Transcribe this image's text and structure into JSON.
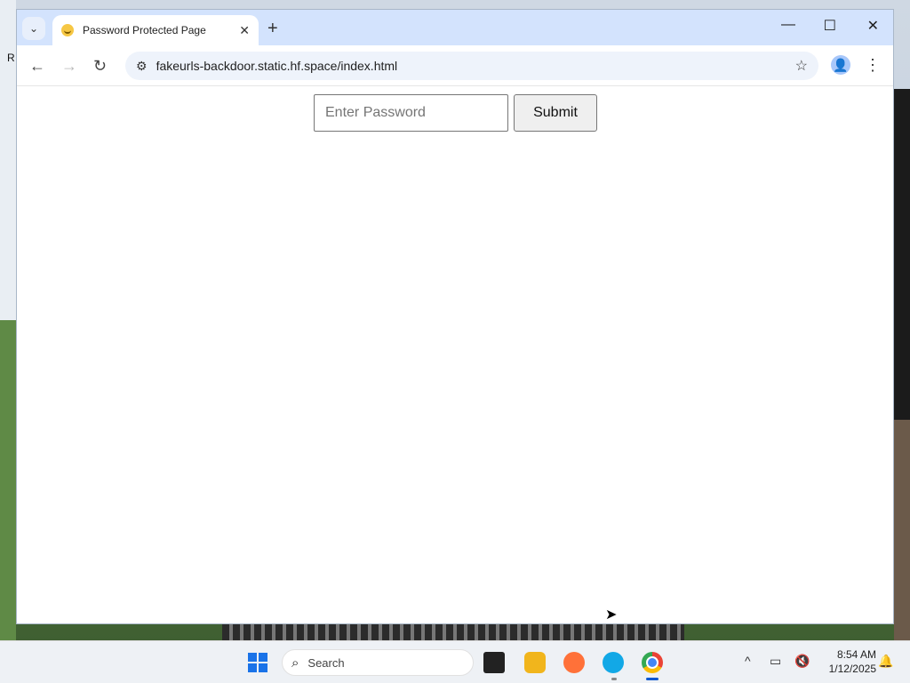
{
  "desktop": {
    "edge_label": "R"
  },
  "browser": {
    "tab": {
      "title": "Password Protected Page",
      "close_glyph": "✕"
    },
    "tab_search_glyph": "⌄",
    "new_tab_glyph": "+",
    "window_controls": {
      "minimize": "—",
      "maximize": "☐",
      "close": "✕"
    },
    "nav": {
      "back": "←",
      "forward": "→",
      "reload": "↻"
    },
    "address_bar": {
      "site_info_glyph": "⚙",
      "url": "fakeurls-backdoor.static.hf.space/index.html",
      "bookmark_glyph": "☆"
    },
    "profile_glyph": "👤",
    "menu_glyph": "⋮"
  },
  "page": {
    "password_placeholder": "Enter Password",
    "submit_label": "Submit"
  },
  "taskbar": {
    "search_label": "Search",
    "search_glyph": "⌕",
    "tray": {
      "chevron": "^",
      "monitor": "▭",
      "volume": "🔇",
      "bell": "🔔"
    },
    "clock": {
      "time": "8:54 AM",
      "date": "1/12/2025"
    }
  },
  "colors": {
    "tabstrip_bg": "#d3e3fd",
    "omnibox_bg": "#eef3fb",
    "chrome_active": "#0b57d0"
  }
}
